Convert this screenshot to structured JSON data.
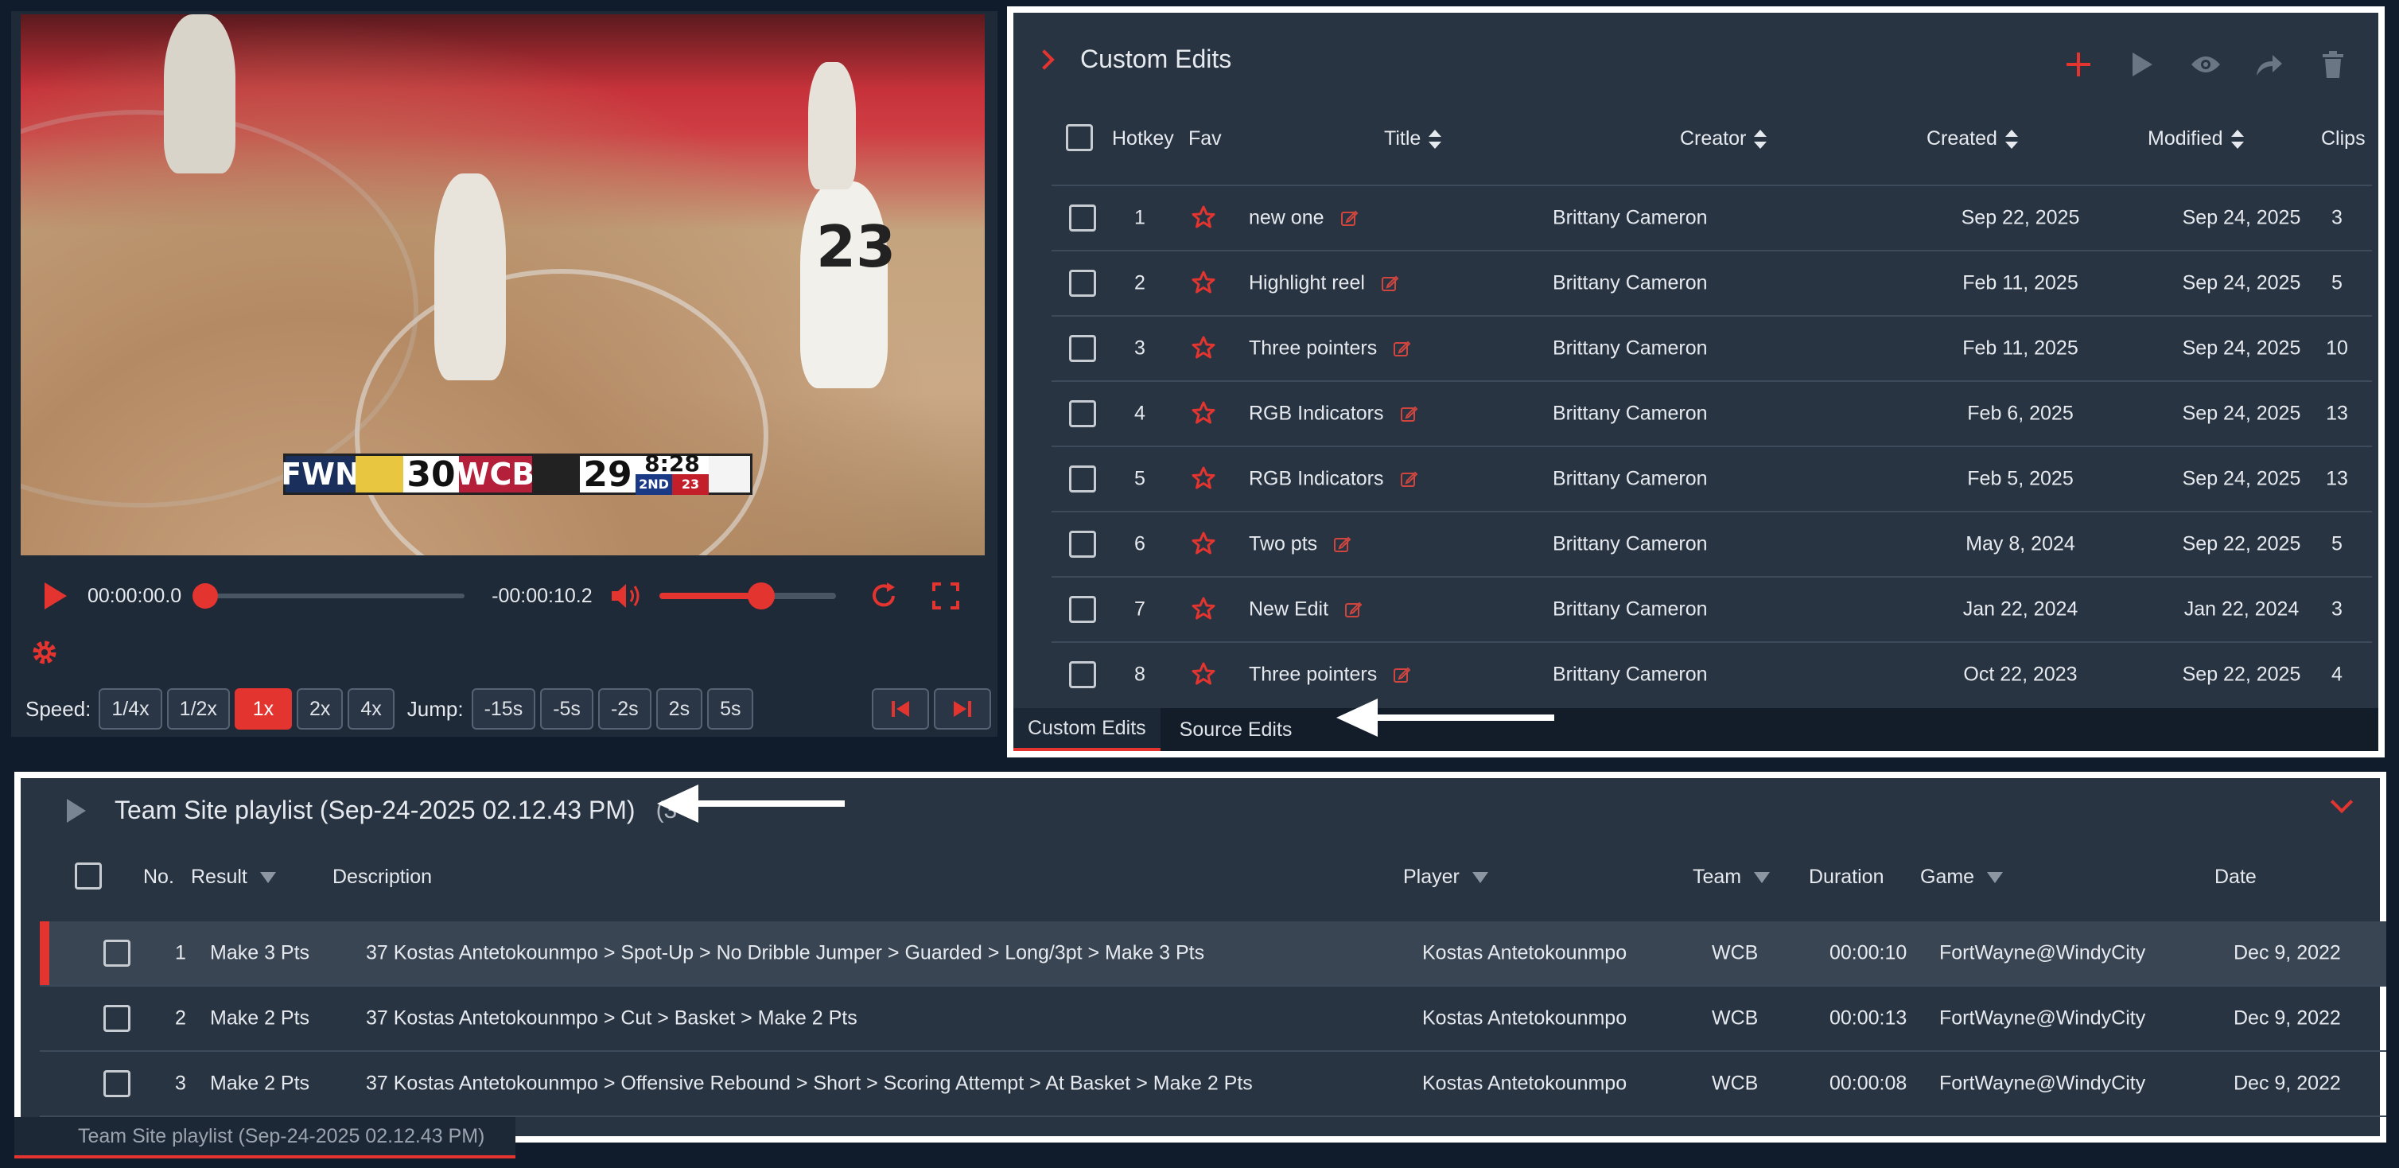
{
  "player": {
    "current_time": "00:00:00.0",
    "remaining_time": "-00:00:10.2",
    "progress_fraction": 0.0,
    "volume_fraction": 0.58,
    "scorebug": {
      "team1": "FWN",
      "score1": "30",
      "team2": "WCB",
      "score2": "29",
      "clock": "8:28",
      "quarter": "2ND",
      "shot_clock": "23"
    },
    "speed_label": "Speed:",
    "speeds": [
      "1/4x",
      "1/2x",
      "1x",
      "2x",
      "4x"
    ],
    "active_speed": "1x",
    "jump_label": "Jump:",
    "jumps": [
      "-15s",
      "-5s",
      "-2s",
      "2s",
      "5s"
    ],
    "jersey_number": "23"
  },
  "edits": {
    "title": "Custom Edits",
    "columns": {
      "hotkey": "Hotkey",
      "fav": "Fav",
      "title": "Title",
      "creator": "Creator",
      "created": "Created",
      "modified": "Modified",
      "clips": "Clips"
    },
    "rows": [
      {
        "hotkey": "1",
        "title": "new one",
        "creator": "Brittany Cameron",
        "created": "Sep 22, 2025",
        "modified": "Sep 24, 2025",
        "clips": "3"
      },
      {
        "hotkey": "2",
        "title": "Highlight reel",
        "creator": "Brittany Cameron",
        "created": "Feb 11, 2025",
        "modified": "Sep 24, 2025",
        "clips": "5"
      },
      {
        "hotkey": "3",
        "title": "Three pointers",
        "creator": "Brittany Cameron",
        "created": "Feb 11, 2025",
        "modified": "Sep 24, 2025",
        "clips": "10"
      },
      {
        "hotkey": "4",
        "title": "RGB Indicators",
        "creator": "Brittany Cameron",
        "created": "Feb 6, 2025",
        "modified": "Sep 24, 2025",
        "clips": "13"
      },
      {
        "hotkey": "5",
        "title": "RGB Indicators",
        "creator": "Brittany Cameron",
        "created": "Feb 5, 2025",
        "modified": "Sep 24, 2025",
        "clips": "13"
      },
      {
        "hotkey": "6",
        "title": "Two pts",
        "creator": "Brittany Cameron",
        "created": "May 8, 2024",
        "modified": "Sep 22, 2025",
        "clips": "5"
      },
      {
        "hotkey": "7",
        "title": "New Edit",
        "creator": "Brittany Cameron",
        "created": "Jan 22, 2024",
        "modified": "Jan 22, 2024",
        "clips": "3"
      },
      {
        "hotkey": "8",
        "title": "Three pointers",
        "creator": "Brittany Cameron",
        "created": "Oct 22, 2023",
        "modified": "Sep 22, 2025",
        "clips": "4"
      }
    ],
    "tabs": [
      "Custom Edits",
      "Source Edits"
    ],
    "active_tab": "Custom Edits"
  },
  "playlist": {
    "title": "Team Site playlist (Sep-24-2025 02.12.43 PM)",
    "count": "(3",
    "columns": {
      "no": "No.",
      "result": "Result",
      "description": "Description",
      "player": "Player",
      "team": "Team",
      "duration": "Duration",
      "game": "Game",
      "date": "Date"
    },
    "rows": [
      {
        "no": "1",
        "result": "Make 3 Pts",
        "description": "37 Kostas Antetokounmpo > Spot-Up > No Dribble Jumper > Guarded > Long/3pt > Make 3 Pts",
        "player": "Kostas Antetokounmpo",
        "team": "WCB",
        "duration": "00:00:10",
        "game": "FortWayne@WindyCity",
        "date": "Dec 9, 2022"
      },
      {
        "no": "2",
        "result": "Make 2 Pts",
        "description": "37 Kostas Antetokounmpo > Cut > Basket > Make 2 Pts",
        "player": "Kostas Antetokounmpo",
        "team": "WCB",
        "duration": "00:00:13",
        "game": "FortWayne@WindyCity",
        "date": "Dec 9, 2022"
      },
      {
        "no": "3",
        "result": "Make 2 Pts",
        "description": "37 Kostas Antetokounmpo > Offensive Rebound > Short > Scoring Attempt > At Basket > Make 2 Pts",
        "player": "Kostas Antetokounmpo",
        "team": "WCB",
        "duration": "00:00:08",
        "game": "FortWayne@WindyCity",
        "date": "Dec 9, 2022"
      }
    ],
    "bottom_tab": "Team Site playlist (Sep-24-2025 02.12.43 PM)"
  },
  "colors": {
    "accent": "#e3342f",
    "panel": "#283442",
    "background": "#101b2b"
  }
}
